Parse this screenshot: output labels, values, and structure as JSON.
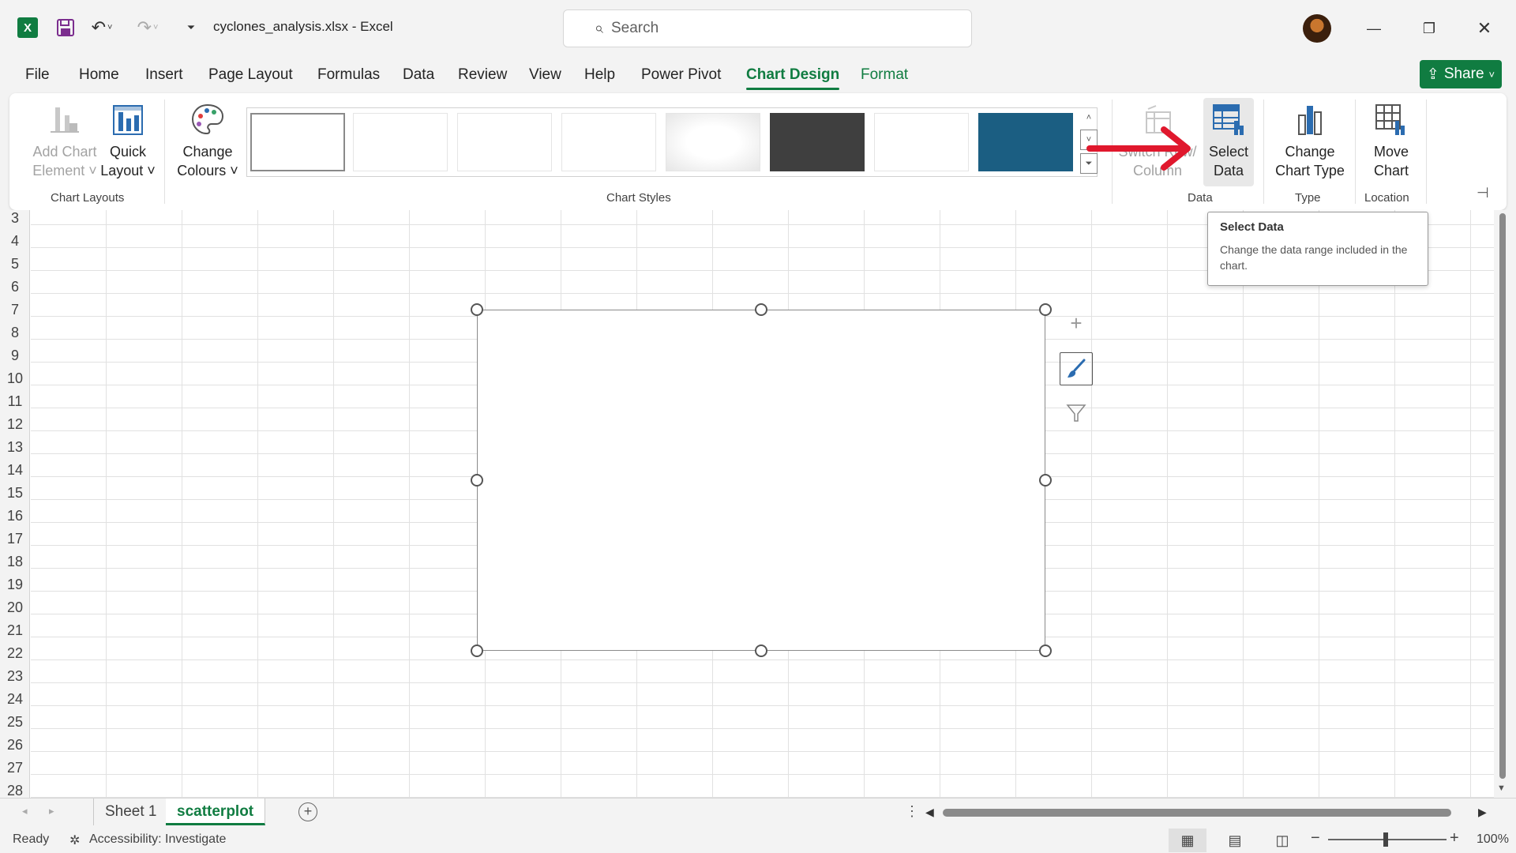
{
  "titlebar": {
    "app_icon_letter": "X",
    "doc_title": "cyclones_analysis.xlsx  -  Excel",
    "search_placeholder": "Search",
    "minimize": "—",
    "maximize": "❐",
    "close": "✕"
  },
  "menu": {
    "tabs": [
      "File",
      "Home",
      "Insert",
      "Page Layout",
      "Formulas",
      "Data",
      "Review",
      "View",
      "Help",
      "Power Pivot",
      "Chart Design",
      "Format"
    ],
    "active_tab": "Chart Design",
    "share_label": "Share"
  },
  "ribbon": {
    "add_chart_element": [
      "Add Chart",
      "Element ˅"
    ],
    "quick_layout": [
      "Quick",
      "Layout ˅"
    ],
    "change_colours": [
      "Change",
      "Colours ˅"
    ],
    "switch_row_column": [
      "Switch Row/",
      "Column"
    ],
    "select_data": [
      "Select",
      "Data"
    ],
    "change_chart_type": [
      "Change",
      "Chart Type"
    ],
    "move_chart": [
      "Move",
      "Chart"
    ],
    "groups": {
      "chart_layouts": "Chart Layouts",
      "chart_styles": "Chart Styles",
      "data": "Data",
      "type": "Type",
      "location": "Location"
    },
    "style_colors": [
      "#ffffff",
      "#ffffff",
      "#ffffff",
      "#ffffff",
      "#f2f2f2",
      "#3f3f3f",
      "#ffffff",
      "#1b5e82"
    ]
  },
  "tooltip": {
    "title": "Select Data",
    "body": "Change the data range included in the chart."
  },
  "grid": {
    "row_numbers": [
      "3",
      "4",
      "5",
      "6",
      "7",
      "8",
      "9",
      "10",
      "11",
      "12",
      "13",
      "14",
      "15",
      "16",
      "17",
      "18",
      "19",
      "20",
      "21",
      "22",
      "23",
      "24",
      "25",
      "26",
      "27",
      "28"
    ]
  },
  "sheets": {
    "tabs": [
      "Sheet 1",
      "scatterplot"
    ],
    "active": "scatterplot"
  },
  "status": {
    "ready": "Ready",
    "accessibility": "Accessibility: Investigate",
    "zoom": "100%"
  },
  "colors": {
    "accent": "#107c41",
    "annotation_arrow": "#e0182d"
  }
}
